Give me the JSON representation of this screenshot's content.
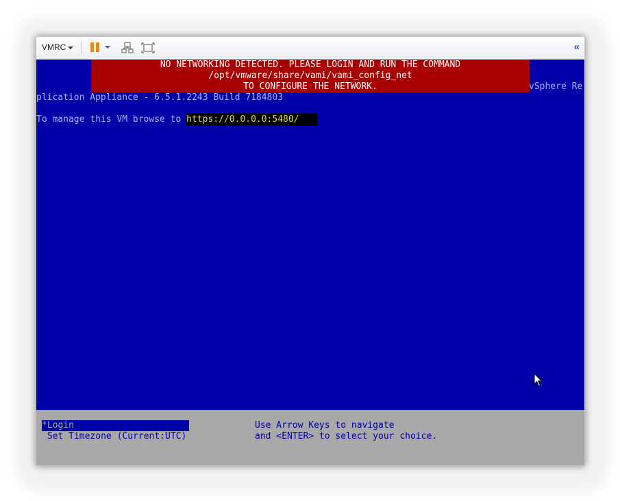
{
  "toolbar": {
    "vmrc_label": "VMRC",
    "icons": [
      "pause-icon",
      "send-ctrl-alt-del-icon",
      "fullscreen-icon",
      "collapse-icon"
    ],
    "collapse_label": "«"
  },
  "console": {
    "banner": {
      "line1": "NO NETWORKING DETECTED. PLEASE LOGIN AND RUN THE COMMAND",
      "line2": "/opt/vmware/share/vami/vami_config_net",
      "line3": "TO CONFIGURE THE NETWORK."
    },
    "title_right": "vSphere Re",
    "title_left": "plication Appliance - 6.5.1.2243 Build 7184803",
    "manage_text": "To manage this VM browse to ",
    "manage_url": "https://0.0.0.0:5480/"
  },
  "bottom_menu": {
    "items": [
      "*Login",
      " Set Timezone (Current:UTC)"
    ],
    "help_line1": "Use Arrow Keys to navigate",
    "help_line2": "and <ENTER> to select your choice."
  },
  "colors": {
    "console_bg": "#0000a8",
    "banner_bg": "#a80000",
    "menu_bg": "#a8a8a8",
    "pause_accent": "#e08a24"
  }
}
